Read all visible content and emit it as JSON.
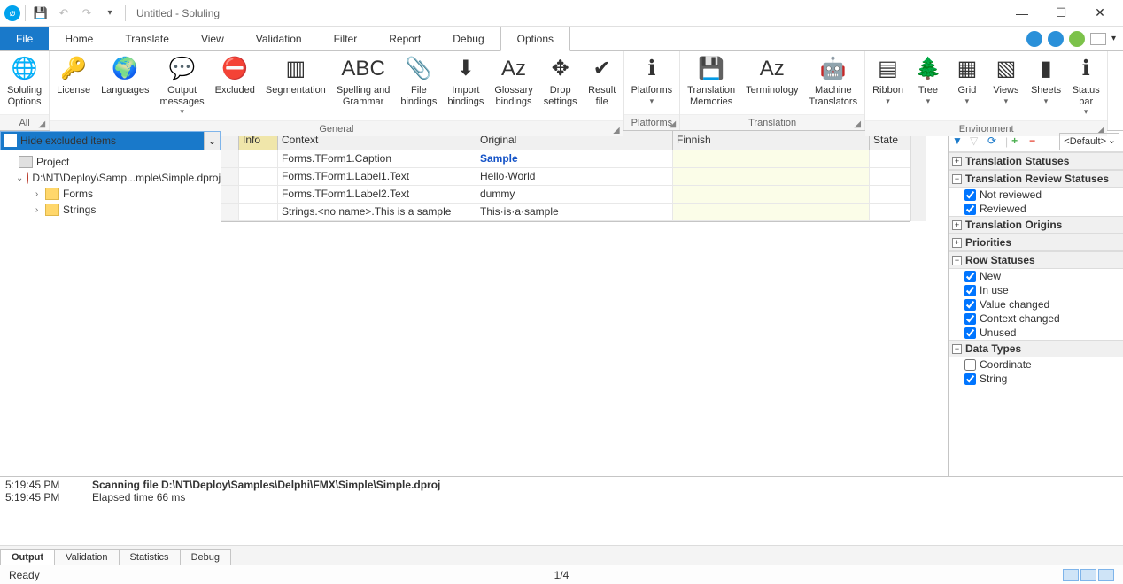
{
  "title": "Untitled  -  Soluling",
  "menu": {
    "file": "File",
    "home": "Home",
    "translate": "Translate",
    "view": "View",
    "validation": "Validation",
    "filter": "Filter",
    "report": "Report",
    "debug": "Debug",
    "options": "Options"
  },
  "ribbon": {
    "groups": [
      {
        "label": "All",
        "items": [
          {
            "k": "soluling",
            "l": "Soluling Options",
            "ico": "🌐"
          }
        ]
      },
      {
        "label": "General",
        "items": [
          {
            "k": "license",
            "l": "License",
            "ico": "🔑"
          },
          {
            "k": "languages",
            "l": "Languages",
            "ico": "🌍"
          },
          {
            "k": "output",
            "l": "Output messages",
            "ico": "💬",
            "dd": true
          },
          {
            "k": "excluded",
            "l": "Excluded",
            "ico": "⛔"
          },
          {
            "k": "segmentation",
            "l": "Segmentation",
            "ico": "▥"
          },
          {
            "k": "spelling",
            "l": "Spelling and Grammar",
            "ico": "ABC"
          },
          {
            "k": "filebind",
            "l": "File bindings",
            "ico": "📎"
          },
          {
            "k": "importbind",
            "l": "Import bindings",
            "ico": "⬇"
          },
          {
            "k": "glossary",
            "l": "Glossary bindings",
            "ico": "Aᴢ"
          },
          {
            "k": "drop",
            "l": "Drop settings",
            "ico": "✥"
          },
          {
            "k": "result",
            "l": "Result file",
            "ico": "✔"
          }
        ]
      },
      {
        "label": "Platforms",
        "items": [
          {
            "k": "platforms",
            "l": "Platforms",
            "ico": "ℹ",
            "dd": true
          }
        ]
      },
      {
        "label": "Translation",
        "items": [
          {
            "k": "tm",
            "l": "Translation Memories",
            "ico": "💾"
          },
          {
            "k": "term",
            "l": "Terminology",
            "ico": "Aᴢ"
          },
          {
            "k": "mt",
            "l": "Machine Translators",
            "ico": "🤖"
          }
        ]
      },
      {
        "label": "Environment",
        "items": [
          {
            "k": "ribbonv",
            "l": "Ribbon",
            "ico": "▤",
            "dd": true
          },
          {
            "k": "treev",
            "l": "Tree",
            "ico": "🌲",
            "dd": true
          },
          {
            "k": "gridv",
            "l": "Grid",
            "ico": "▦",
            "dd": true
          },
          {
            "k": "viewsv",
            "l": "Views",
            "ico": "▧",
            "dd": true
          },
          {
            "k": "sheetsv",
            "l": "Sheets",
            "ico": "▮",
            "dd": true
          },
          {
            "k": "statusv",
            "l": "Status bar",
            "ico": "ℹ",
            "dd": true
          }
        ]
      }
    ]
  },
  "left": {
    "combo": "Hide excluded items",
    "project": "Project",
    "file": "D:\\NT\\Deploy\\Samp...mple\\Simple.dproj",
    "nodes": [
      "Forms",
      "Strings"
    ]
  },
  "grid": {
    "headers": {
      "info": "Info",
      "context": "Context",
      "original": "Original",
      "finnish": "Finnish",
      "state": "State"
    },
    "rows": [
      {
        "context": "Forms.TForm1.Caption",
        "original": "Sample",
        "hl": true
      },
      {
        "context": "Forms.TForm1.Label1.Text",
        "original": "Hello·World"
      },
      {
        "context": "Forms.TForm1.Label2.Text",
        "original": "dummy"
      },
      {
        "context": "Strings.<no name>.This is a sample",
        "original": "This·is·a·sample"
      }
    ]
  },
  "right": {
    "default": "<Default>",
    "sections": {
      "ts": "Translation Statuses",
      "trs": "Translation Review Statuses",
      "to": "Translation Origins",
      "pr": "Priorities",
      "rs": "Row Statuses",
      "dt": "Data Types"
    },
    "trs": [
      {
        "l": "Not reviewed",
        "c": true
      },
      {
        "l": "Reviewed",
        "c": true
      }
    ],
    "rs": [
      {
        "l": "New",
        "c": true
      },
      {
        "l": "In use",
        "c": true
      },
      {
        "l": "Value changed",
        "c": true
      },
      {
        "l": "Context changed",
        "c": true
      },
      {
        "l": "Unused",
        "c": true
      }
    ],
    "dt": [
      {
        "l": "Coordinate",
        "c": false
      },
      {
        "l": "String",
        "c": true
      }
    ]
  },
  "output": {
    "lines": [
      {
        "ts": "5:19:45 PM",
        "msg": "Scanning file D:\\NT\\Deploy\\Samples\\Delphi\\FMX\\Simple\\Simple.dproj",
        "b": true
      },
      {
        "ts": "5:19:45 PM",
        "msg": "Elapsed time 66 ms"
      }
    ],
    "tabs": [
      "Output",
      "Validation",
      "Statistics",
      "Debug"
    ]
  },
  "status": {
    "ready": "Ready",
    "pos": "1/4"
  }
}
